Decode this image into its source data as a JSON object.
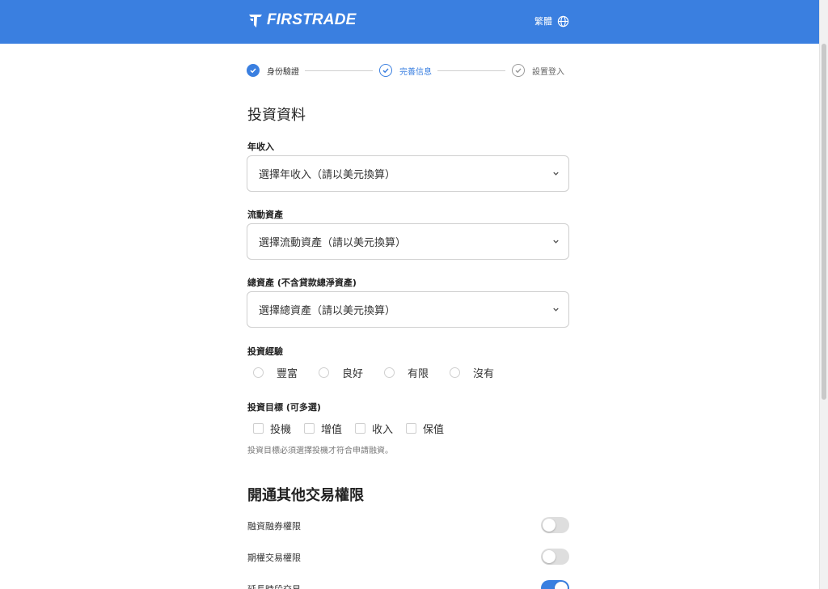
{
  "header": {
    "brand": "FIRSTRADE",
    "language": "繁體"
  },
  "steps": [
    {
      "label": "身份驗證",
      "state": "done"
    },
    {
      "label": "完善信息",
      "state": "current"
    },
    {
      "label": "設置登入",
      "state": "pending"
    }
  ],
  "section1": {
    "title": "投資資料"
  },
  "income": {
    "label": "年收入",
    "placeholder": "選擇年收入（請以美元換算）"
  },
  "liquid_assets": {
    "label": "流動資產",
    "placeholder": "選擇流動資產（請以美元換算）"
  },
  "total_assets": {
    "label": "總資產 (不含貸款總淨資產)",
    "placeholder": "選擇總資產（請以美元換算）"
  },
  "experience": {
    "label": "投資經驗",
    "options": [
      "豐富",
      "良好",
      "有限",
      "沒有"
    ]
  },
  "objectives": {
    "label": "投資目標 (可多選)",
    "options": [
      "投機",
      "增值",
      "收入",
      "保值"
    ],
    "hint": "投資目標必須選擇投機才符合申請融資。"
  },
  "section2": {
    "title": "開通其他交易權限"
  },
  "permissions": [
    {
      "label": "融資融券權限",
      "enabled": false
    },
    {
      "label": "期權交易權限",
      "enabled": false
    },
    {
      "label": "延長時段交易",
      "enabled": true
    }
  ],
  "colors": {
    "brand": "#3a7fe0",
    "toggle_off": "#dedede"
  }
}
